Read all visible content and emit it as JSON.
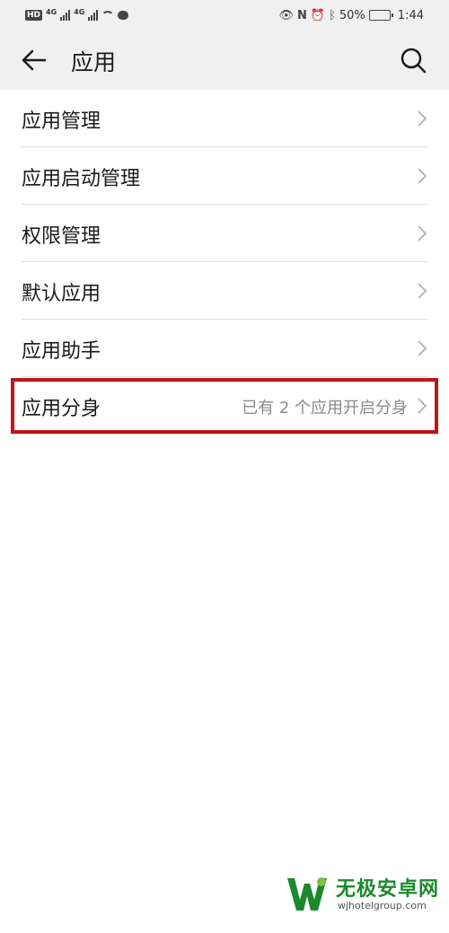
{
  "status_bar": {
    "hd": "HD",
    "net1": "4G",
    "net2": "4G",
    "battery_pct": "50%",
    "battery_level": 0.5,
    "time": "1:44"
  },
  "header": {
    "back_icon": "arrow-left-icon",
    "title": "应用",
    "search_icon": "search-icon"
  },
  "list": {
    "items": [
      {
        "label": "应用管理",
        "sub": ""
      },
      {
        "label": "应用启动管理",
        "sub": ""
      },
      {
        "label": "权限管理",
        "sub": ""
      },
      {
        "label": "默认应用",
        "sub": ""
      },
      {
        "label": "应用助手",
        "sub": ""
      },
      {
        "label": "应用分身",
        "sub": "已有 2 个应用开启分身"
      }
    ]
  },
  "highlight_color": "#c0131a",
  "watermark": {
    "name": "无极安卓网",
    "url": "wjhotelgroup.com"
  }
}
